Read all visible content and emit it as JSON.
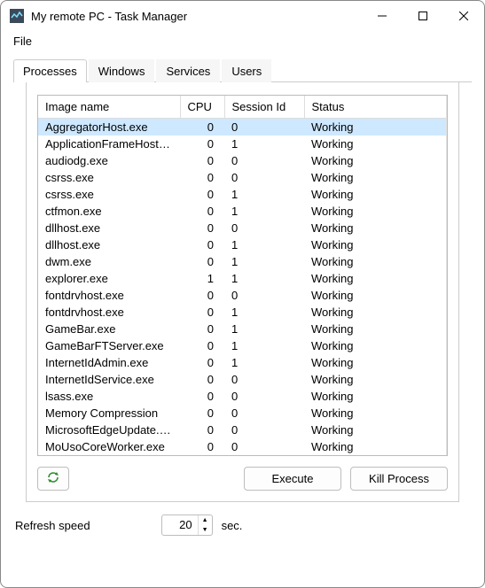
{
  "window": {
    "title": "My remote PC - Task Manager",
    "icon_name": "task-manager-icon"
  },
  "menubar": {
    "file": "File"
  },
  "tabs": [
    {
      "label": "Processes",
      "active": true
    },
    {
      "label": "Windows",
      "active": false
    },
    {
      "label": "Services",
      "active": false
    },
    {
      "label": "Users",
      "active": false
    }
  ],
  "table": {
    "headers": {
      "image_name": "Image name",
      "cpu": "CPU",
      "session_id": "Session Id",
      "status": "Status"
    },
    "rows": [
      {
        "image_name": "AggregatorHost.exe",
        "cpu": 0,
        "session_id": 0,
        "status": "Working",
        "selected": true
      },
      {
        "image_name": "ApplicationFrameHost.exe",
        "cpu": 0,
        "session_id": 1,
        "status": "Working"
      },
      {
        "image_name": "audiodg.exe",
        "cpu": 0,
        "session_id": 0,
        "status": "Working"
      },
      {
        "image_name": "csrss.exe",
        "cpu": 0,
        "session_id": 0,
        "status": "Working"
      },
      {
        "image_name": "csrss.exe",
        "cpu": 0,
        "session_id": 1,
        "status": "Working"
      },
      {
        "image_name": "ctfmon.exe",
        "cpu": 0,
        "session_id": 1,
        "status": "Working"
      },
      {
        "image_name": "dllhost.exe",
        "cpu": 0,
        "session_id": 0,
        "status": "Working"
      },
      {
        "image_name": "dllhost.exe",
        "cpu": 0,
        "session_id": 1,
        "status": "Working"
      },
      {
        "image_name": "dwm.exe",
        "cpu": 0,
        "session_id": 1,
        "status": "Working"
      },
      {
        "image_name": "explorer.exe",
        "cpu": 1,
        "session_id": 1,
        "status": "Working"
      },
      {
        "image_name": "fontdrvhost.exe",
        "cpu": 0,
        "session_id": 0,
        "status": "Working"
      },
      {
        "image_name": "fontdrvhost.exe",
        "cpu": 0,
        "session_id": 1,
        "status": "Working"
      },
      {
        "image_name": "GameBar.exe",
        "cpu": 0,
        "session_id": 1,
        "status": "Working"
      },
      {
        "image_name": "GameBarFTServer.exe",
        "cpu": 0,
        "session_id": 1,
        "status": "Working"
      },
      {
        "image_name": "InternetIdAdmin.exe",
        "cpu": 0,
        "session_id": 1,
        "status": "Working"
      },
      {
        "image_name": "InternetIdService.exe",
        "cpu": 0,
        "session_id": 0,
        "status": "Working"
      },
      {
        "image_name": "lsass.exe",
        "cpu": 0,
        "session_id": 0,
        "status": "Working"
      },
      {
        "image_name": "Memory Compression",
        "cpu": 0,
        "session_id": 0,
        "status": "Working"
      },
      {
        "image_name": "MicrosoftEdgeUpdate.exe",
        "cpu": 0,
        "session_id": 0,
        "status": "Working"
      },
      {
        "image_name": "MoUsoCoreWorker.exe",
        "cpu": 0,
        "session_id": 0,
        "status": "Working"
      }
    ]
  },
  "buttons": {
    "refresh_icon": "refresh-icon",
    "execute": "Execute",
    "kill_process": "Kill Process"
  },
  "footer": {
    "refresh_speed_label": "Refresh speed",
    "refresh_speed_value": 20,
    "refresh_speed_unit": "sec."
  }
}
